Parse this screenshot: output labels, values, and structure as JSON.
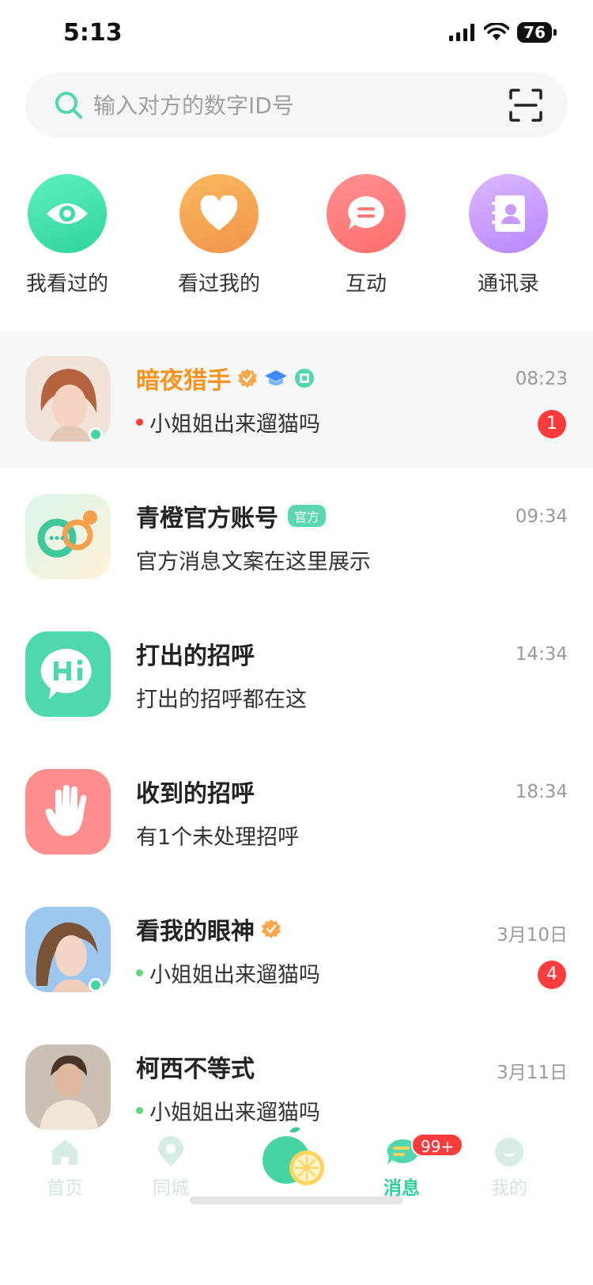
{
  "status_bar": {
    "time": "5:13",
    "battery": "76"
  },
  "search": {
    "placeholder": "输入对方的数字ID号"
  },
  "shortcuts": [
    {
      "label": "我看过的",
      "icon": "eye-icon",
      "color": "#3fdba8"
    },
    {
      "label": "看过我的",
      "icon": "heart-icon",
      "color": "#f6a04d"
    },
    {
      "label": "互动",
      "icon": "chat-bubble-icon",
      "color": "#ff7b7b"
    },
    {
      "label": "通讯录",
      "icon": "contacts-icon",
      "color": "#c79bff"
    }
  ],
  "conversations": [
    {
      "name": "暗夜猎手",
      "time": "08:23",
      "preview": "小姐姐出来遛猫吗",
      "unread": "1",
      "online": true,
      "dot_color": "#ff3b3b"
    },
    {
      "name": "青橙官方账号",
      "tag": "官方",
      "time": "09:34",
      "preview": "官方消息文案在这里展示"
    },
    {
      "name": "打出的招呼",
      "time": "14:34",
      "preview": "打出的招呼都在这"
    },
    {
      "name": "收到的招呼",
      "time": "18:34",
      "preview": "有1个未处理招呼"
    },
    {
      "name": "看我的眼神",
      "time": "3月10日",
      "preview": "小姐姐出来遛猫吗",
      "unread": "4",
      "online": true,
      "dot_color": "#5fd87a"
    },
    {
      "name": "柯西不等式",
      "time": "3月11日",
      "preview": "小姐姐出来遛猫吗",
      "dot_color": "#5fd87a"
    }
  ],
  "tabbar": {
    "home": "首页",
    "city": "同城",
    "messages": "消息",
    "messages_badge": "99+",
    "mine": "我的"
  },
  "colors": {
    "accent": "#2fcf9c",
    "badge": "#ff3b3b",
    "vip_name": "#f8931f"
  }
}
